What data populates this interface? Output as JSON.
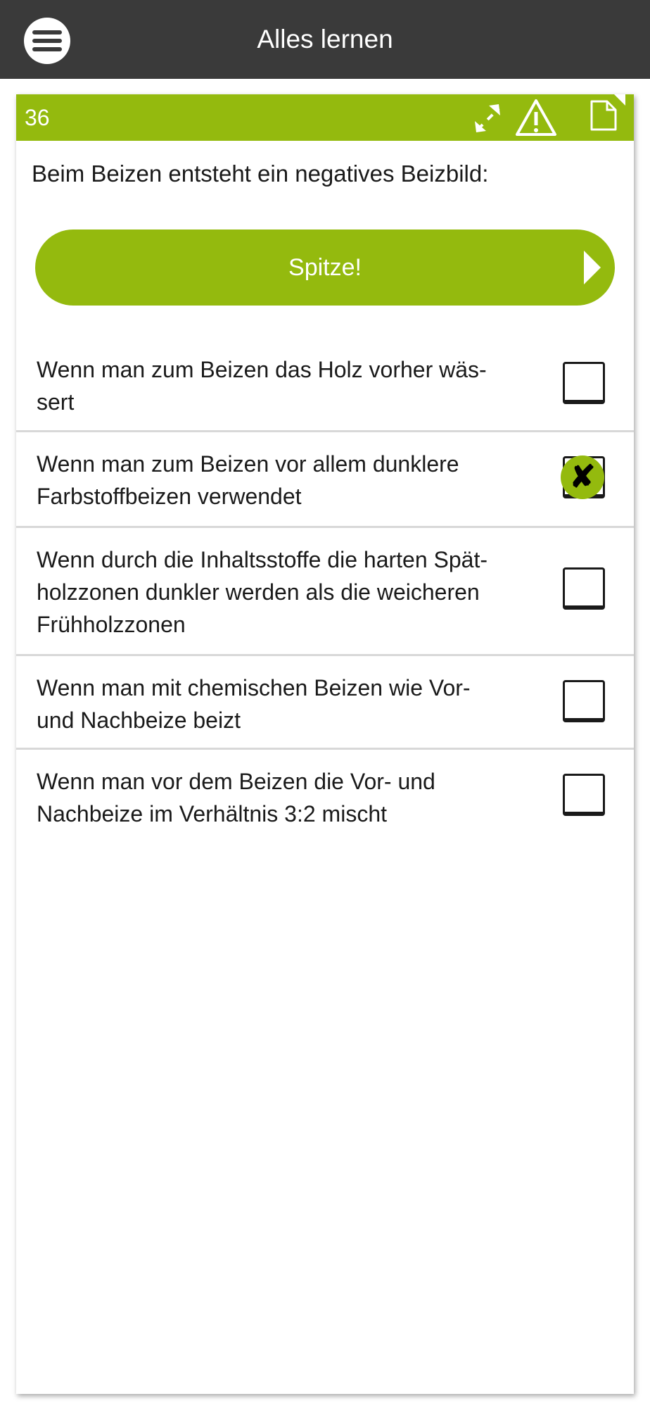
{
  "app": {
    "title": "Alles lernen",
    "accent_color": "#94ba0e",
    "topbar_color": "#3a3a3a"
  },
  "card": {
    "number": "36",
    "icons": [
      "expand-icon",
      "warning-icon",
      "document-icon"
    ],
    "question": "Beim Beizen entsteht ein negatives Beizbild:",
    "feedback_button_label": "Spitze!",
    "answers": [
      {
        "text": "Wenn man zum Beizen das Holz vorher wäs-\nsert",
        "checked": false
      },
      {
        "text": "Wenn man zum Beizen vor allem dunklere\nFarbstoffbeizen verwendet",
        "checked": true,
        "mark": "✘"
      },
      {
        "text": "Wenn durch die Inhaltsstoffe die harten Spät-\nholzzonen dunkler werden als die weicheren\nFrühholzzonen",
        "checked": false
      },
      {
        "text": "Wenn man mit chemischen Beizen wie Vor-\nund Nachbeize beizt",
        "checked": false
      },
      {
        "text": "Wenn man vor dem Beizen die Vor- und\nNachbeize im Verhältnis 3:2 mischt",
        "checked": false
      }
    ]
  }
}
